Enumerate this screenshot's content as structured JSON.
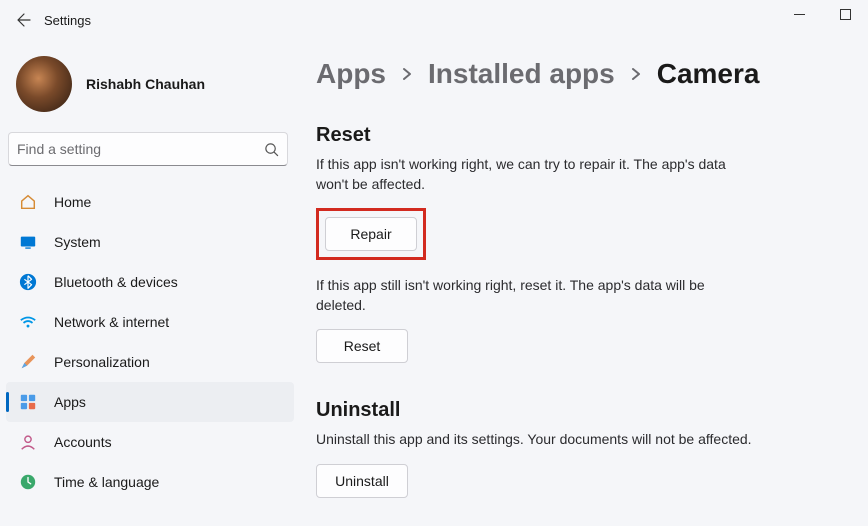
{
  "window": {
    "title": "Settings"
  },
  "user": {
    "name": "Rishabh Chauhan"
  },
  "search": {
    "placeholder": "Find a setting"
  },
  "nav": {
    "home": "Home",
    "system": "System",
    "bluetooth": "Bluetooth & devices",
    "network": "Network & internet",
    "personalization": "Personalization",
    "apps": "Apps",
    "accounts": "Accounts",
    "time": "Time & language"
  },
  "breadcrumb": {
    "apps": "Apps",
    "installed": "Installed apps",
    "current": "Camera"
  },
  "reset": {
    "title": "Reset",
    "desc1": "If this app isn't working right, we can try to repair it. The app's data won't be affected.",
    "repair_btn": "Repair",
    "desc2": "If this app still isn't working right, reset it. The app's data will be deleted.",
    "reset_btn": "Reset"
  },
  "uninstall": {
    "title": "Uninstall",
    "desc": "Uninstall this app and its settings. Your documents will not be affected.",
    "btn": "Uninstall"
  }
}
